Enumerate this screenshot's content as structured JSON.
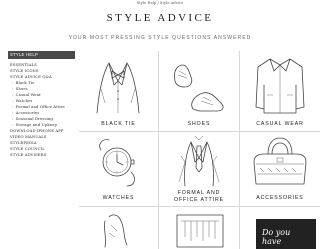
{
  "breadcrumb": "Style Help / Style Advice",
  "page_title": "STYLE ADVICE",
  "subtitle": "YOUR MOST PRESSING STYLE QUESTIONS ANSWERED",
  "sidebar": {
    "heading": "STYLE HELP",
    "items": [
      {
        "label": "ESSENTIALS",
        "sub": false
      },
      {
        "label": "STYLE ICONS",
        "sub": false
      },
      {
        "label": "STYLE ADVICE Q&A",
        "sub": false
      },
      {
        "label": "Black Tie",
        "sub": true
      },
      {
        "label": "Shoes",
        "sub": true
      },
      {
        "label": "Casual Wear",
        "sub": true
      },
      {
        "label": "Watches",
        "sub": true
      },
      {
        "label": "Formal and Office Attire",
        "sub": true
      },
      {
        "label": "Accessories",
        "sub": true
      },
      {
        "label": "Seasonal Dressing",
        "sub": true
      },
      {
        "label": "Storage and Upkeep",
        "sub": true
      },
      {
        "label": "DOWNLOAD IPHONE APP",
        "sub": false
      },
      {
        "label": "VIDEO MANUALS",
        "sub": false
      },
      {
        "label": "STYLEPEDIA",
        "sub": false
      },
      {
        "label": "STYLE COUNCIL",
        "sub": false
      },
      {
        "label": "STYLE ADVISERS",
        "sub": false
      }
    ]
  },
  "tiles": {
    "black_tie": "BLACK TIE",
    "shoes": "SHOES",
    "casual_wear": "CASUAL WEAR",
    "watches": "WATCHES",
    "formal_line1": "FORMAL AND",
    "formal_line2": "OFFICE ATTIRE",
    "accessories": "ACCESSORIES"
  },
  "promo_text": "Do you have"
}
